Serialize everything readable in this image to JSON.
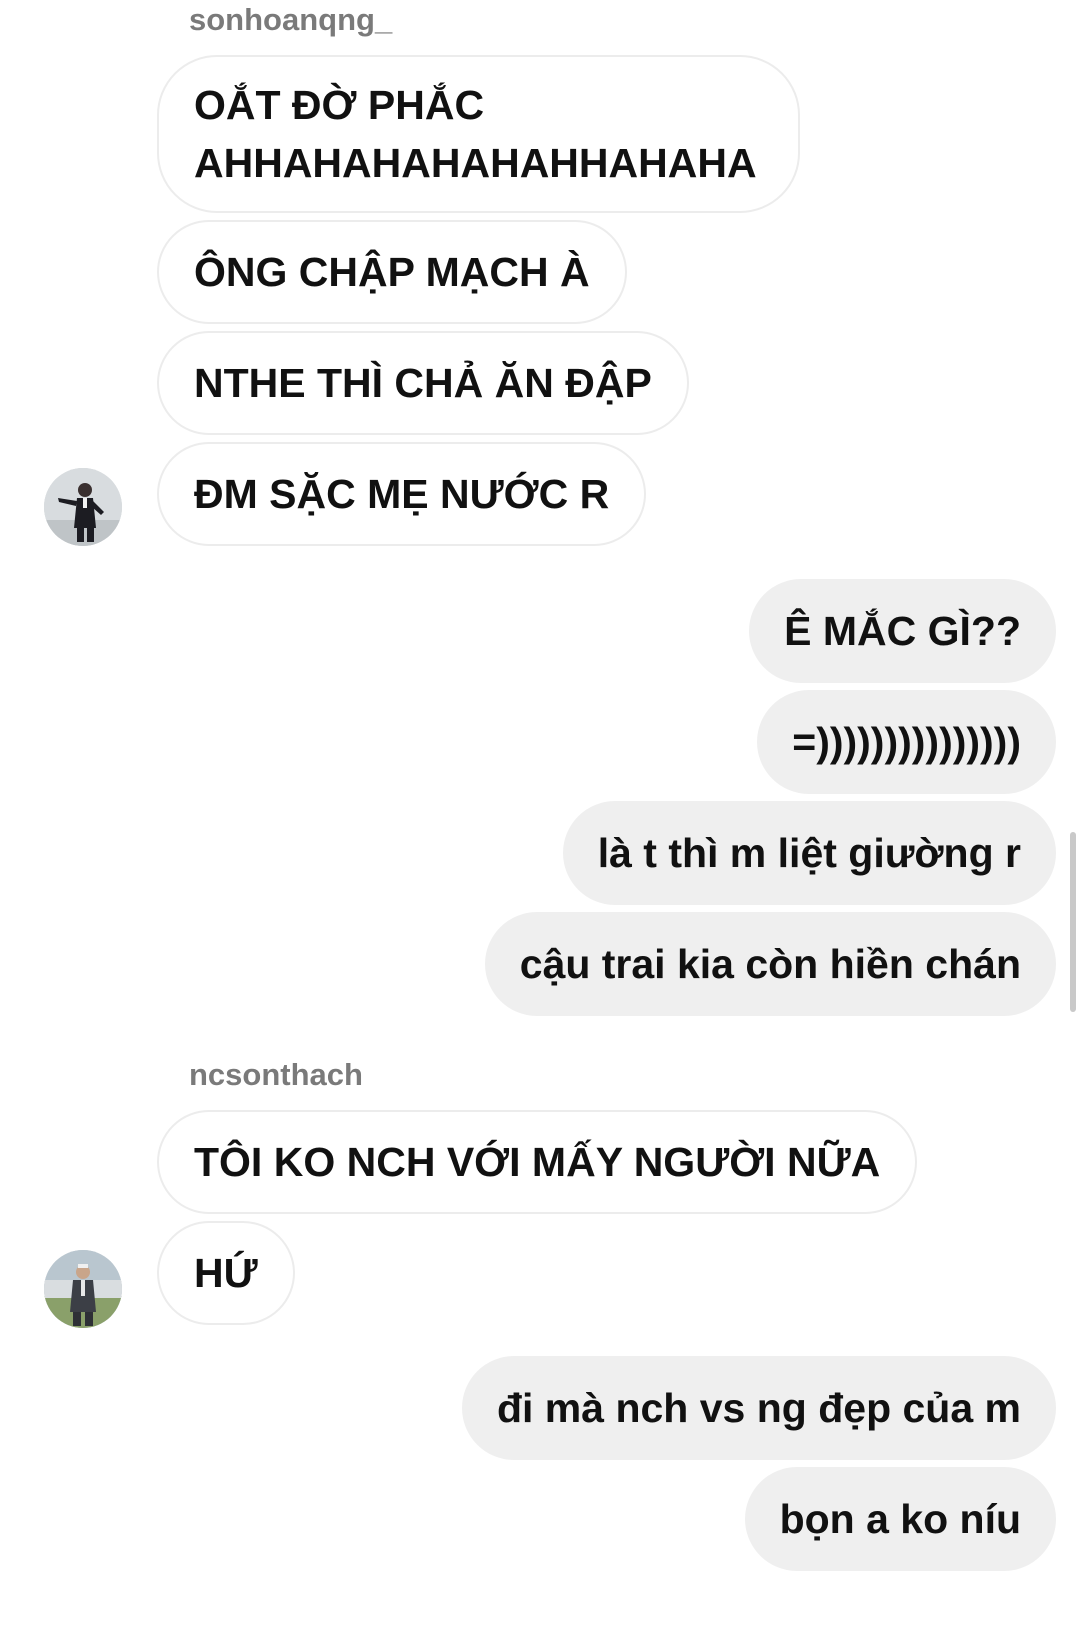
{
  "thread": {
    "group1": {
      "sender": "sonhoanqng_",
      "messages": [
        "OẮT ĐỜ PHẮC AHHAHAHAHAHAHHAHAHA",
        "ÔNG CHẬP MẠCH À",
        "NTHE THÌ CHẢ ĂN ĐẬP",
        "ĐM SẶC MẸ NƯỚC R"
      ],
      "avatar_icon": "person-in-suit-avatar"
    },
    "outgoing1": [
      "Ê MẮC GÌ??",
      "=)))))))))))))))",
      "là t thì m liệt giường r",
      "cậu trai kia còn hiền chán"
    ],
    "group2": {
      "sender": "ncsonthach",
      "messages": [
        "TÔI KO NCH VỚI MẤY NGƯỜI NỮA",
        "HỨ"
      ],
      "avatar_icon": "person-outdoors-avatar"
    },
    "outgoing2": [
      "đi mà nch vs ng đẹp của m",
      "bọn a ko níu"
    ]
  },
  "colors": {
    "incoming_bubble_bg": "#ffffff",
    "incoming_bubble_border": "#ececec",
    "outgoing_bubble_bg": "#efefef",
    "sender_name": "#7a7a7a",
    "text": "#111111"
  }
}
